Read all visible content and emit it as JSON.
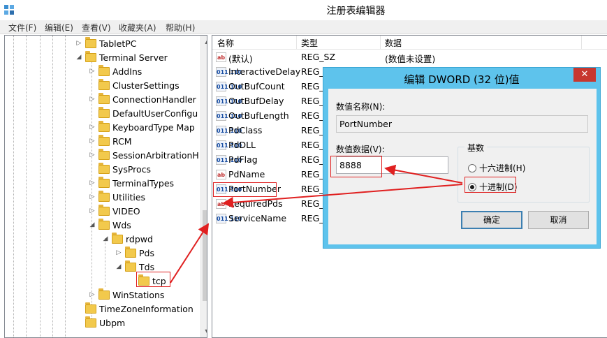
{
  "window": {
    "title": "注册表编辑器"
  },
  "menu": [
    "文件(F)",
    "编辑(E)",
    "查看(V)",
    "收藏夹(A)",
    "帮助(H)"
  ],
  "tree": [
    {
      "label": "TabletPC",
      "expander": "▷"
    },
    {
      "label": "Terminal Server",
      "expander": "◢"
    },
    {
      "label": "AddIns",
      "expander": "▷"
    },
    {
      "label": "ClusterSettings",
      "expander": ""
    },
    {
      "label": "ConnectionHandler",
      "expander": "▷"
    },
    {
      "label": "DefaultUserConfigu",
      "expander": ""
    },
    {
      "label": "KeyboardType Map",
      "expander": "▷"
    },
    {
      "label": "RCM",
      "expander": "▷"
    },
    {
      "label": "SessionArbitrationH",
      "expander": "▷"
    },
    {
      "label": "SysProcs",
      "expander": ""
    },
    {
      "label": "TerminalTypes",
      "expander": "▷"
    },
    {
      "label": "Utilities",
      "expander": "▷"
    },
    {
      "label": "VIDEO",
      "expander": "▷"
    },
    {
      "label": "Wds",
      "expander": "◢"
    },
    {
      "label": "rdpwd",
      "expander": "◢"
    },
    {
      "label": "Pds",
      "expander": "▷"
    },
    {
      "label": "Tds",
      "expander": "◢"
    },
    {
      "label": "tcp",
      "expander": ""
    },
    {
      "label": "WinStations",
      "expander": "▷"
    },
    {
      "label": "TimeZoneInformation",
      "expander": ""
    },
    {
      "label": "Ubpm",
      "expander": ""
    }
  ],
  "list": {
    "headers": {
      "name": "名称",
      "type": "类型",
      "data": "数据"
    },
    "rows": [
      {
        "icon": "ab",
        "name": "(默认)",
        "type": "REG_SZ",
        "data": "(数值未设置)"
      },
      {
        "icon": "bin",
        "name": "InteractiveDelay",
        "type": "REG_",
        "data": ""
      },
      {
        "icon": "bin",
        "name": "OutBufCount",
        "type": "REG_",
        "data": ""
      },
      {
        "icon": "bin",
        "name": "OutBufDelay",
        "type": "REG_",
        "data": ""
      },
      {
        "icon": "bin",
        "name": "OutBufLength",
        "type": "REG_",
        "data": ""
      },
      {
        "icon": "bin",
        "name": "PdClass",
        "type": "REG_",
        "data": ""
      },
      {
        "icon": "bin",
        "name": "PdDLL",
        "type": "REG_",
        "data": ""
      },
      {
        "icon": "bin",
        "name": "PdFlag",
        "type": "REG_",
        "data": ""
      },
      {
        "icon": "ab",
        "name": "PdName",
        "type": "REG_",
        "data": ""
      },
      {
        "icon": "bin",
        "name": "PortNumber",
        "type": "REG_",
        "data": ""
      },
      {
        "icon": "ab",
        "name": "RequiredPds",
        "type": "REG_",
        "data": ""
      },
      {
        "icon": "bin",
        "name": "ServiceName",
        "type": "REG_",
        "data": ""
      }
    ]
  },
  "icons": {
    "ab": "ab",
    "bin": "011\n110"
  },
  "dialog": {
    "title": "编辑 DWORD (32 位)值",
    "close": "✕",
    "name_label": "数值名称(N):",
    "name_value": "PortNumber",
    "data_label": "数值数据(V):",
    "data_value": "8888",
    "base_label": "基数",
    "hex_label": "十六进制(H)",
    "dec_label": "十进制(D)",
    "ok": "确定",
    "cancel": "取消"
  },
  "colors": {
    "dialog_frame": "#5ec3ec",
    "close_button": "#c7372f",
    "annotation": "#e02020"
  }
}
